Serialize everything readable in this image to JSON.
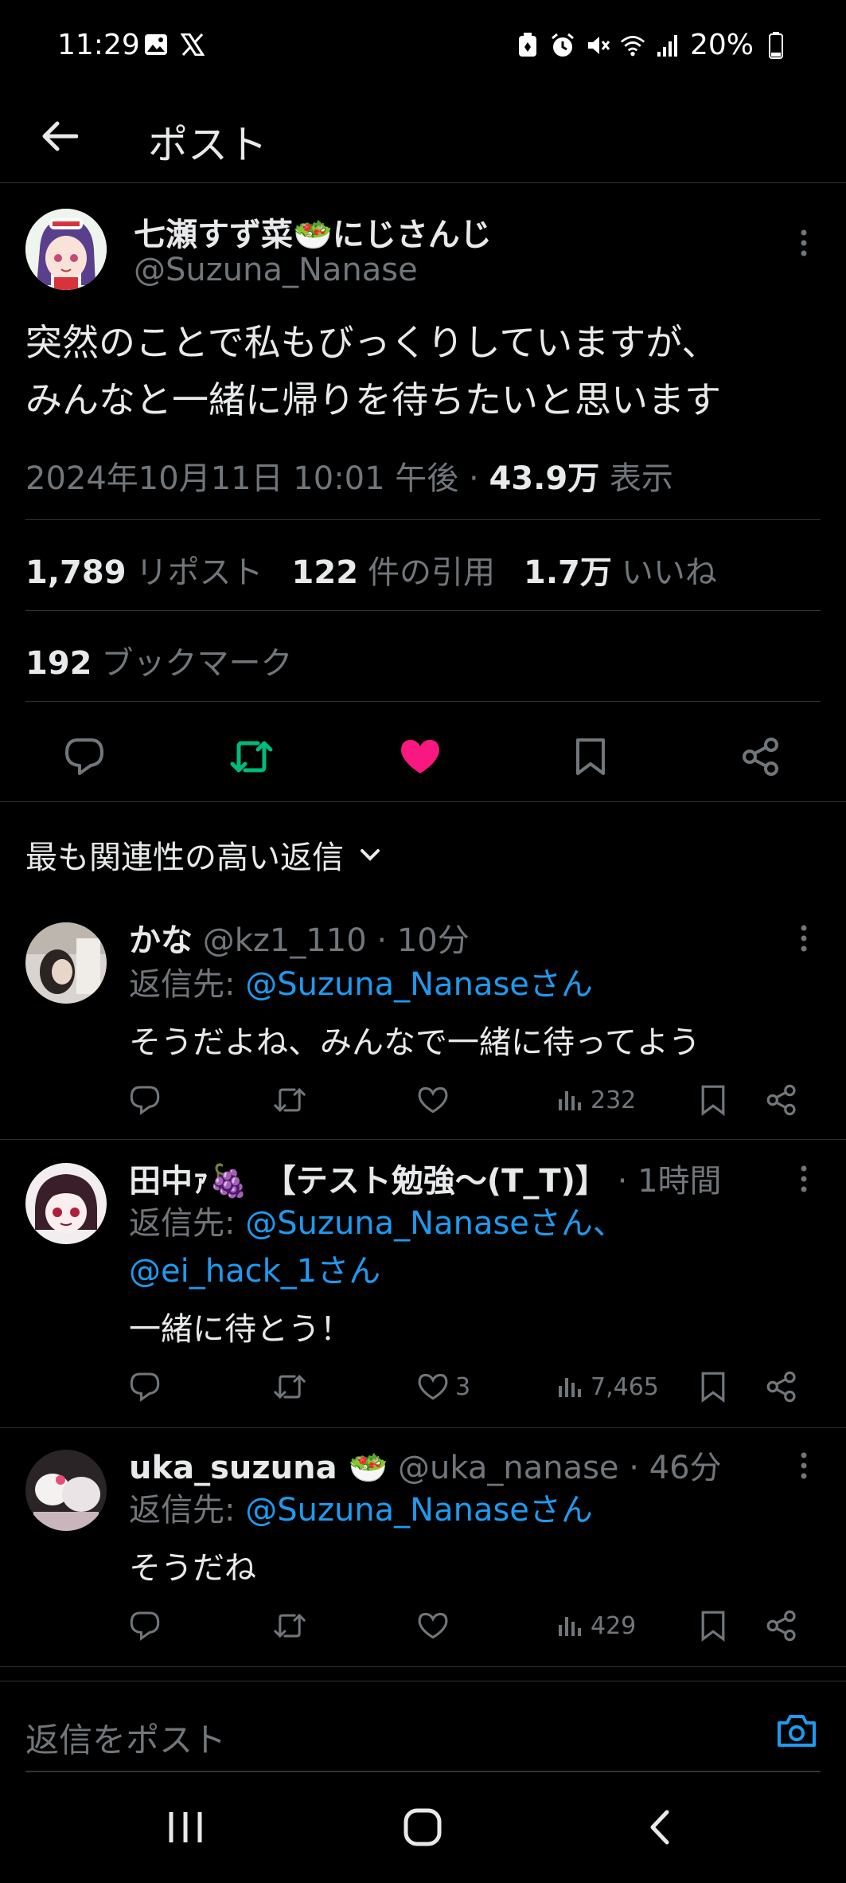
{
  "status_bar": {
    "time": "11:29",
    "battery": "20%",
    "left_icons": [
      "gallery-icon",
      "x-logo-icon"
    ],
    "right_icons": [
      "battery-saver-icon",
      "alarm-icon",
      "mute-icon",
      "wifi-icon",
      "signal-icon",
      "battery-icon"
    ]
  },
  "header": {
    "title": "ポスト"
  },
  "post": {
    "author_name": "七瀬すず菜🥗にじさんじ",
    "author_handle": "@Suzuna_Nanase",
    "text_line1": "突然のことで私もびっくりしていますが、",
    "text_line2": "みんなと一緒に帰りを待ちたいと思います",
    "datetime": "2024年10月11日 10:01 午後 · ",
    "views_count": "43.9万",
    "views_label": " 表示",
    "reposts_count": "1,789",
    "reposts_label": "リポスト",
    "quotes_count": "122",
    "quotes_label": "件の引用",
    "likes_count": "1.7万",
    "likes_label": "いいね",
    "bookmarks_count": "192",
    "bookmarks_label": "ブックマーク"
  },
  "sort": {
    "label": "最も関連性の高い返信"
  },
  "replies": [
    {
      "name": "かな",
      "handle": "@kz1_110",
      "time": " · 10分",
      "reply_to_label": "返信先: ",
      "reply_to_mention": "@Suzuna_Nanaseさん",
      "reply_to_mention2": "",
      "text": "そうだよね、みんなで一緒に待ってよう",
      "likes": "",
      "views": "232"
    },
    {
      "name": "田中ｧ🍇　【テスト勉強〜(T_T)】",
      "handle": "",
      "time": " · 1時間",
      "reply_to_label": "返信先: ",
      "reply_to_mention": "@Suzuna_Nanaseさん、",
      "reply_to_mention2": "@ei_hack_1さん",
      "text": "一緒に待とう！",
      "likes": "3",
      "views": "7,465"
    },
    {
      "name": "uka_suzuna 🥗",
      "handle": " @uka_nanase",
      "time": " · 46分",
      "reply_to_label": "返信先: ",
      "reply_to_mention": "@Suzuna_Nanaseさん",
      "reply_to_mention2": "",
      "text": "そうだね",
      "likes": "",
      "views": "429"
    }
  ],
  "compose": {
    "placeholder": "返信をポスト"
  },
  "colors": {
    "background": "#000000",
    "accent_blue": "#1d9bf0",
    "repost_green": "#00ba7c",
    "like_pink": "#f91880",
    "muted": "#71767b",
    "text": "#e7e9ea"
  }
}
